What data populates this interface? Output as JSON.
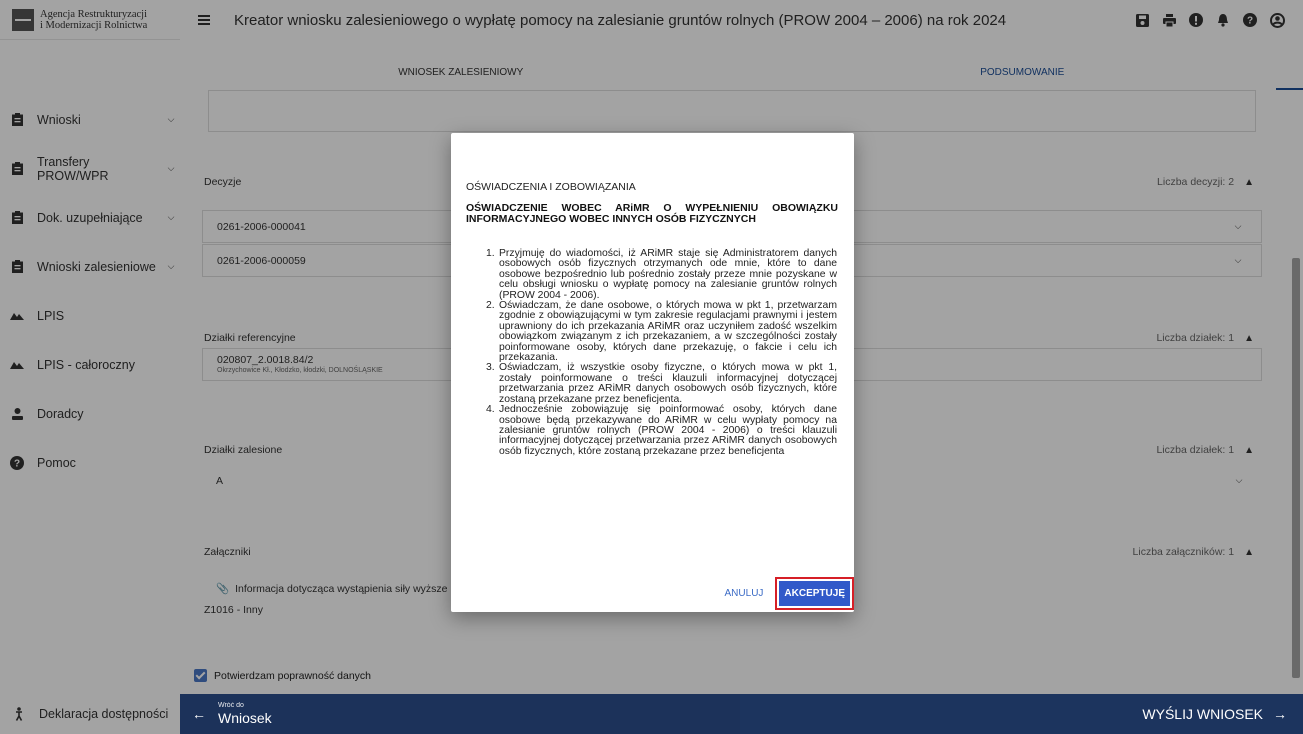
{
  "app": {
    "org_line1": "Agencja Restrukturyzacji",
    "org_line2": "i Modernizacji Rolnictwa",
    "title": "Kreator wniosku zalesieniowego o wypłatę pomocy na zalesianie gruntów rolnych (PROW 2004 – 2006) na rok 2024"
  },
  "toolbar_icons": [
    "save-icon",
    "print-icon",
    "alert-icon",
    "bell-icon",
    "help-icon",
    "user-icon"
  ],
  "sidebar": {
    "items": [
      {
        "label": "Wnioski",
        "icon": "clipboard-icon",
        "expandable": true
      },
      {
        "label": "Transfery PROW/WPR",
        "icon": "clipboard-icon",
        "expandable": true
      },
      {
        "label": "Dok. uzupełniające",
        "icon": "clipboard-icon",
        "expandable": true
      },
      {
        "label": "Wnioski zalesieniowe",
        "icon": "clipboard-icon",
        "expandable": true
      },
      {
        "label": "LPIS",
        "icon": "terrain-icon",
        "expandable": false
      },
      {
        "label": "LPIS - całoroczny",
        "icon": "terrain-icon",
        "expandable": false
      },
      {
        "label": "Doradcy",
        "icon": "person-icon",
        "expandable": false
      },
      {
        "label": "Pomoc",
        "icon": "help-icon",
        "expandable": false
      }
    ],
    "footer": "Deklaracja dostępności"
  },
  "tabs": [
    {
      "label": "WNIOSEK ZALESIENIOWY",
      "active": false
    },
    {
      "label": "PODSUMOWANIE",
      "active": true
    }
  ],
  "sections": {
    "decisions": {
      "title": "Decyzje",
      "count": "Liczba decyzji: 2",
      "rows": [
        "0261-2006-000041",
        "0261-2006-000059"
      ]
    },
    "reference_plots": {
      "title": "Działki referencyjne",
      "count": "Liczba działek: 1",
      "rows": [
        {
          "main": "020807_2.0018.84/2",
          "sub": "Okrzychowice Kł., Kłodzko, kłodzki, DOLNOŚLĄSKIE"
        }
      ]
    },
    "forested_plots": {
      "title": "Działki zalesione",
      "count": "Liczba działek: 1",
      "rows": [
        "A"
      ]
    },
    "attachments": {
      "title": "Załączniki",
      "count": "Liczba załączników: 1",
      "item": "Informacja dotycząca wystąpienia siły wyższe",
      "code": "Z1016 - Inny"
    }
  },
  "confirm_label": "Potwierdzam poprawność danych",
  "footer": {
    "back_label": "Wróć do",
    "back_target": "Wniosek",
    "send_label": "WYŚLIJ WNIOSEK"
  },
  "modal": {
    "header": "OŚWIADCZENIA I ZOBOWIĄZANIA",
    "subtitle": "OŚWIADCZENIE WOBEC ARiMR O WYPEŁNIENIU OBOWIĄZKU INFORMACYJNEGO WOBEC INNYCH OSÓB FIZYCZNYCH",
    "items": [
      {
        "num": "1.",
        "text": "Przyjmuję do wiadomości, iż ARiMR staje się Administratorem danych osobowych osób fizycznych otrzymanych ode mnie, które to dane osobowe bezpośrednio lub pośrednio zostały przeze mnie pozyskane w celu obsługi wniosku o wypłatę pomocy na zalesianie gruntów rolnych (PROW 2004 - 2006)."
      },
      {
        "num": "2.",
        "text": "Oświadczam, że dane osobowe, o których mowa w pkt 1, przetwarzam zgodnie z obowiązującymi w tym zakresie regulacjami prawnymi i jestem uprawniony do ich przekazania ARiMR oraz uczyniłem zadość wszelkim obowiązkom związanym z ich przekazaniem, a w szczególności zostały poinformowane osoby, których dane przekazuję, o fakcie i celu ich przekazania."
      },
      {
        "num": "3.",
        "text": "Oświadczam, iż wszystkie osoby fizyczne, o których mowa w pkt 1, zostały poinformowane o treści klauzuli informacyjnej dotyczącej przetwarzania przez ARiMR danych osobowych osób fizycznych, które zostaną przekazane przez beneficjenta."
      },
      {
        "num": "4.",
        "text": "Jednocześnie zobowiązuję się poinformować osoby, których dane osobowe będą przekazywane do ARiMR w celu wypłaty pomocy na zalesianie gruntów rolnych (PROW 2004 - 2006) o treści klauzuli informacyjnej dotyczącej przetwarzania przez ARiMR danych osobowych osób fizycznych, które zostaną przekazane przez beneficjenta"
      }
    ],
    "cancel_label": "ANULUJ",
    "accept_label": "AKCEPTUJĘ"
  },
  "colors": {
    "primary": "#2c4f8e",
    "accent": "#3159c9",
    "highlight": "#d61f26",
    "overlay": "rgba(0,0,0,0.36)"
  }
}
